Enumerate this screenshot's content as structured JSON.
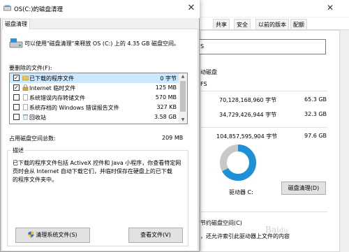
{
  "background_window": {
    "tabs": [
      "共享",
      "安全",
      "以前的版本",
      "配额"
    ],
    "name_value": "S",
    "type_label": "动磁盘",
    "fs_value": "FS",
    "used_bytes": "70,128,168,960 字节",
    "used_gb": "65.3 GB",
    "free_bytes": "34,729,426,944 字节",
    "free_gb": "32.3 GB",
    "capacity_bytes": "104,857,595,904 字节",
    "capacity_gb": "97.6 GB",
    "drive_label": "驱动器 C:",
    "cleanup_button": "磁盘清理(D)",
    "compress_line": "节约磁盘空间(C)",
    "index_line": "，还允许索引此驱动器上文件的内容",
    "used_fraction": 0.669,
    "colors": {
      "used": "#1e90d8",
      "free": "#c8c8c8"
    }
  },
  "dialog": {
    "title": "OS(C:)的磁盘清理",
    "tab": "磁盘清理",
    "intro": "可以使用\"磁盘清理\"来释放 OS (C:) 上的 4.35 GB 磁盘空间。",
    "files_label": "要删除的文件(F):",
    "files": [
      {
        "name": "已下载的程序文件",
        "size": "0 字节",
        "checked": true,
        "selected": true,
        "icon": "folder-icon"
      },
      {
        "name": "Internet 临时文件",
        "size": "125 MB",
        "checked": true,
        "selected": false,
        "icon": "lock-icon"
      },
      {
        "name": "系统错误内存转储文件",
        "size": "570 MB",
        "checked": false,
        "selected": false,
        "icon": "file-icon"
      },
      {
        "name": "系统存档的 Windows 错误报告文件",
        "size": "327 KB",
        "checked": false,
        "selected": false,
        "icon": "file-icon"
      },
      {
        "name": "回收站",
        "size": "3.58 GB",
        "checked": false,
        "selected": false,
        "icon": "recycle-bin-icon"
      }
    ],
    "total_label": "占用磁盘空间总数:",
    "total_value": "209 MB",
    "desc_label": "描述",
    "desc_lines": [
      "已下载的程序文件包括 ActiveX 控件和 Java 小程序，你查看特定网",
      "页时会从 Internet 自动下载它们，并临时保存在硬盘上的已下载",
      "的程序文件夹中。"
    ],
    "cleanup_system_button": "清理系统文件(S)",
    "view_files_button": "查看文件(V)"
  }
}
